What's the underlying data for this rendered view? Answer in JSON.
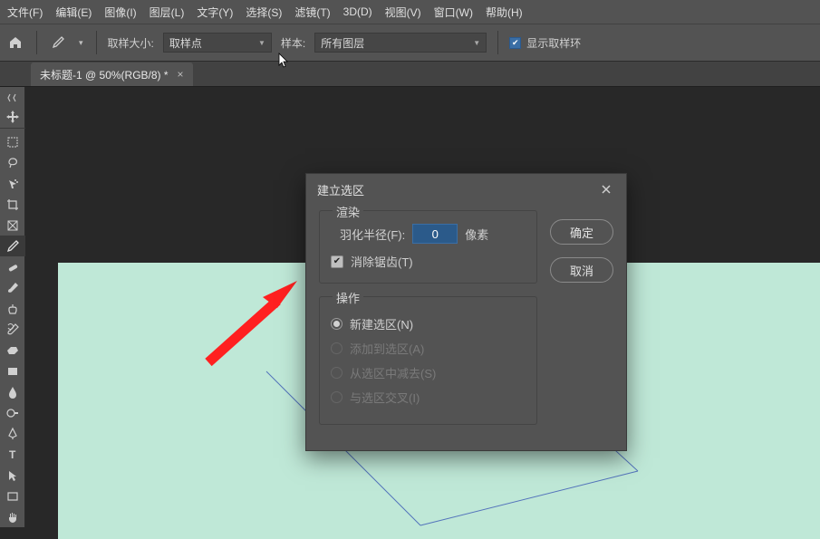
{
  "menu": {
    "items": [
      "文件(F)",
      "编辑(E)",
      "图像(I)",
      "图层(L)",
      "文字(Y)",
      "选择(S)",
      "滤镜(T)",
      "3D(D)",
      "视图(V)",
      "窗口(W)",
      "帮助(H)"
    ]
  },
  "options": {
    "sample_size_label": "取样大小:",
    "sample_size_value": "取样点",
    "sample_label": "样本:",
    "sample_value": "所有图层",
    "show_ring_label": "显示取样环"
  },
  "tab": {
    "title": "未标题-1 @ 50%(RGB/8) *"
  },
  "dialog": {
    "title": "建立选区",
    "render_legend": "渲染",
    "feather_label": "羽化半径(F):",
    "feather_value": "0",
    "feather_unit": "像素",
    "antialias_label": "消除锯齿(T)",
    "ops_legend": "操作",
    "op_new": "新建选区(N)",
    "op_add": "添加到选区(A)",
    "op_sub": "从选区中减去(S)",
    "op_int": "与选区交叉(I)",
    "ok": "确定",
    "cancel": "取消"
  }
}
